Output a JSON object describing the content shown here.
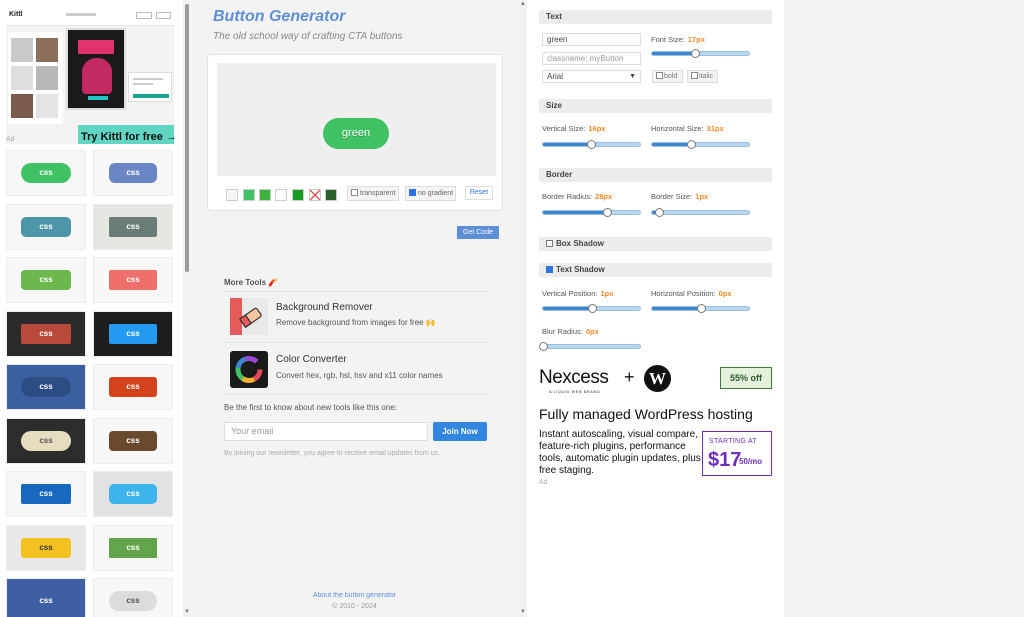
{
  "left_ad": {
    "cta": "Try Kittl for free →",
    "ad_label": "Ad",
    "mock_logo": "Kittl"
  },
  "gallery": {
    "tile_label": "css",
    "tiles": [
      {
        "bg": "#3ec263",
        "frame": "#f7f7f7",
        "radius": "12px"
      },
      {
        "bg": "#6b86c4",
        "frame": "#f7f7f7",
        "radius": "6px"
      },
      {
        "bg": "#4f95aa",
        "frame": "#f7f7f7",
        "radius": "5px"
      },
      {
        "bg": "#6a7c78",
        "frame": "#e7e7e2",
        "radius": "2px"
      },
      {
        "bg": "#6cb84f",
        "frame": "#f7f7f7",
        "radius": "4px"
      },
      {
        "bg": "#ee6f6b",
        "frame": "#f7f7f7",
        "radius": "2px"
      },
      {
        "bg": "#b94a3b",
        "frame": "#2b2b2b",
        "radius": "2px"
      },
      {
        "bg": "#239bf0",
        "frame": "#1d1d1d",
        "radius": "2px"
      },
      {
        "bg": "#2b4d84",
        "frame": "#3b5fa0",
        "radius": "14px"
      },
      {
        "bg": "#d2421c",
        "frame": "#f7f7f7",
        "radius": "3px"
      },
      {
        "bg": "#e6ddc0",
        "frame": "#2c2c2c",
        "radius": "10px",
        "fg": "#555"
      },
      {
        "bg": "#6a4a2e",
        "frame": "#f7f7f7",
        "radius": "4px"
      },
      {
        "bg": "#1769c0",
        "frame": "#f7f7f7",
        "radius": "2px"
      },
      {
        "bg": "#3db3ec",
        "frame": "#e2e2e2",
        "radius": "5px"
      },
      {
        "bg": "#f3c221",
        "frame": "#e8e8e8",
        "radius": "3px",
        "fg": "#333"
      },
      {
        "bg": "#63a44b",
        "frame": "#f7f7f7",
        "radius": "1px"
      },
      {
        "bg": "#3e5fa4",
        "frame": "#3e5fa4",
        "radius": "1px"
      },
      {
        "bg": "#dcdcdc",
        "frame": "#f7f7f7",
        "radius": "10px",
        "fg": "#555"
      }
    ]
  },
  "header": {
    "title": "Button Generator",
    "tagline": "The old school way of crafting CTA buttons"
  },
  "preview": {
    "button_label": "green",
    "button_color": "#3ec263",
    "swatches": [
      "#f4f4f4",
      "#3ec263",
      "#3cb23c",
      "#ffffff",
      "#169c24",
      "#ffffff",
      "#2c5f2c"
    ],
    "transparent_label": "transparent",
    "no_gradient_label": "no gradient",
    "reset_label": "Reset",
    "get_code_label": "Get Code"
  },
  "more_tools": {
    "title": "More Tools 🧨",
    "items": [
      {
        "title": "Background Remover",
        "desc": "Remove background from images for free 🙌"
      },
      {
        "title": "Color Converter",
        "desc": "Convert hex, rgb, hsl, hsv and x11 color names"
      }
    ],
    "newsletter_text": "Be the first to know about new tools like this one:",
    "email_placeholder": "Your email",
    "join_label": "Join Now",
    "newsletter_note": "By joining our newsletter, you agree to receive email updates from us."
  },
  "footer": {
    "about_link": "About the button generator",
    "copyright": "© 2010 - 2024"
  },
  "settings": {
    "text": {
      "section_label": "Text",
      "text_value": "green",
      "classname_placeholder": "classname: myButton",
      "font_family": "Arial",
      "font_size_label": "Font Size:",
      "font_size_value": "17px",
      "font_size_pos": 0.44,
      "bold_label": "bold",
      "italic_label": "italic"
    },
    "size": {
      "section_label": "Size",
      "vertical_label": "Vertical Size:",
      "vertical_value": "16px",
      "vertical_pos": 0.49,
      "horizontal_label": "Horizontal Size:",
      "horizontal_value": "31px",
      "horizontal_pos": 0.4
    },
    "border": {
      "section_label": "Border",
      "radius_label": "Border Radius:",
      "radius_value": "28px",
      "radius_pos": 0.66,
      "size_label": "Border Size:",
      "size_value": "1px",
      "size_pos": 0.07
    },
    "box_shadow": {
      "section_label": "Box Shadow"
    },
    "text_shadow": {
      "section_label": "Text Shadow",
      "vertical_label": "Vertical Position:",
      "vertical_value": "1px",
      "vertical_pos": 0.51,
      "horizontal_label": "Horizontal Position:",
      "horizontal_value": "0px",
      "horizontal_pos": 0.5,
      "blur_label": "Blur Radius:",
      "blur_value": "0px",
      "blur_pos": 0.0
    }
  },
  "right_ad": {
    "brand": "Nexcess",
    "plus": "+",
    "sub": "A LIQUID WEB BRAND",
    "discount": "55% off",
    "headline": "Fully managed WordPress hosting",
    "body": "Instant autoscaling, visual compare, feature-rich plugins, performance tools, automatic plugin updates, plus free staging.",
    "price_label": "STARTING AT",
    "price": "$17",
    "price_suffix": "50/mo",
    "ad_label": "Ad"
  }
}
